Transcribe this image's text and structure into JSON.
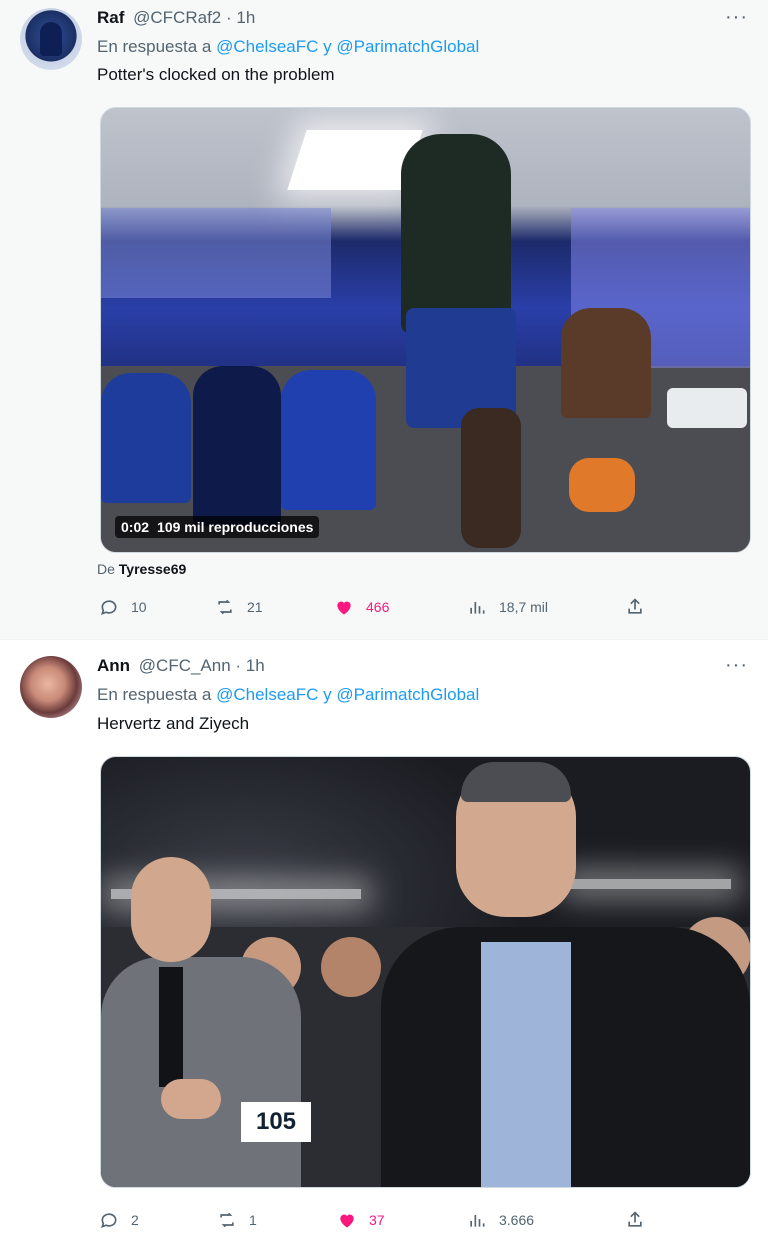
{
  "tweets": [
    {
      "name": "Raf",
      "handle": "@CFCRaf2",
      "time": "· 1h",
      "more_label": "···",
      "reply_prefix": "En respuesta a",
      "reply_mention_1": "@ChelseaFC",
      "reply_and": "y",
      "reply_mention_2": "@ParimatchGlobal",
      "text": "Potter's clocked on the problem",
      "video_time": "0:02",
      "video_views": "109 mil reproducciones",
      "from_prefix": "De",
      "from_user": "Tyresse69",
      "stats": {
        "replies": "10",
        "retweets": "21",
        "likes": "466",
        "views": "18,7 mil"
      }
    },
    {
      "name": "Ann",
      "handle": "@CFC_Ann",
      "time": "· 1h",
      "more_label": "···",
      "reply_prefix": "En respuesta a",
      "reply_mention_1": "@ChelseaFC",
      "reply_and": "y",
      "reply_mention_2": "@ParimatchGlobal",
      "text": "Hervertz and Ziyech",
      "photo_bib_number": "105",
      "stats": {
        "replies": "2",
        "retweets": "1",
        "likes": "37",
        "views": "3.666"
      }
    }
  ],
  "icons": {
    "reply": "reply-icon",
    "retweet": "retweet-icon",
    "like": "heart-icon",
    "views": "views-chart-icon",
    "share": "share-icon"
  },
  "colors": {
    "link": "#1d9bf0",
    "like": "#f91880",
    "muted": "#536471"
  }
}
